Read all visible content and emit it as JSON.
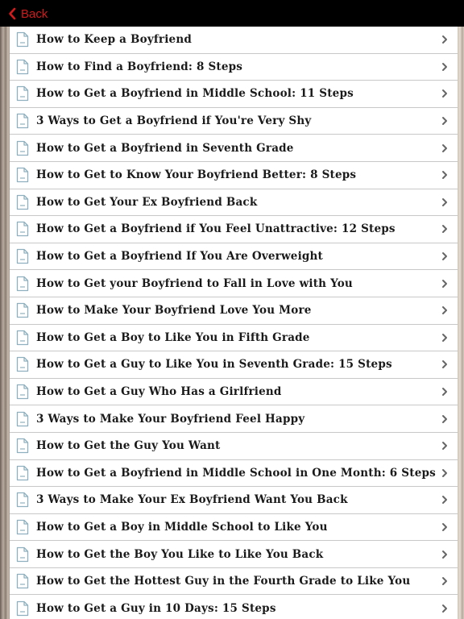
{
  "nav": {
    "back_label": "Back",
    "back_icon": "chevron-left-icon",
    "accent_color": "#d21b1b"
  },
  "list": {
    "item_icon": "document-icon",
    "disclosure_icon": "chevron-right-icon",
    "items": [
      {
        "title": "How to Keep a Boyfriend"
      },
      {
        "title": "How to Find a Boyfriend: 8 Steps"
      },
      {
        "title": "How to Get a Boyfriend in Middle School: 11 Steps"
      },
      {
        "title": "3 Ways to Get a Boyfriend if You're Very Shy"
      },
      {
        "title": "How to Get a Boyfriend in Seventh Grade"
      },
      {
        "title": "How to Get to Know Your Boyfriend Better: 8 Steps"
      },
      {
        "title": "How to Get Your Ex Boyfriend Back"
      },
      {
        "title": "How to Get a Boyfriend if You Feel Unattractive: 12 Steps"
      },
      {
        "title": "How to Get a Boyfriend If You Are Overweight"
      },
      {
        "title": "How to Get your Boyfriend to Fall in Love with You"
      },
      {
        "title": "How to Make Your Boyfriend Love You More"
      },
      {
        "title": "How to Get a Boy to Like You in Fifth Grade"
      },
      {
        "title": "How to Get a Guy to Like You in Seventh Grade: 15 Steps"
      },
      {
        "title": "How to Get a Guy Who Has a Girlfriend"
      },
      {
        "title": "3 Ways to Make Your Boyfriend Feel Happy"
      },
      {
        "title": "How to Get the Guy You Want"
      },
      {
        "title": "How to Get a Boyfriend in Middle School in One Month: 6 Steps"
      },
      {
        "title": "3 Ways to Make Your Ex Boyfriend Want You Back"
      },
      {
        "title": "How to Get a Boy in Middle School to Like You"
      },
      {
        "title": "How to Get the Boy You Like to Like You Back"
      },
      {
        "title": "How to Get the Hottest Guy in the Fourth Grade to Like You"
      },
      {
        "title": "How to Get a Guy in 10 Days: 15 Steps"
      }
    ]
  }
}
